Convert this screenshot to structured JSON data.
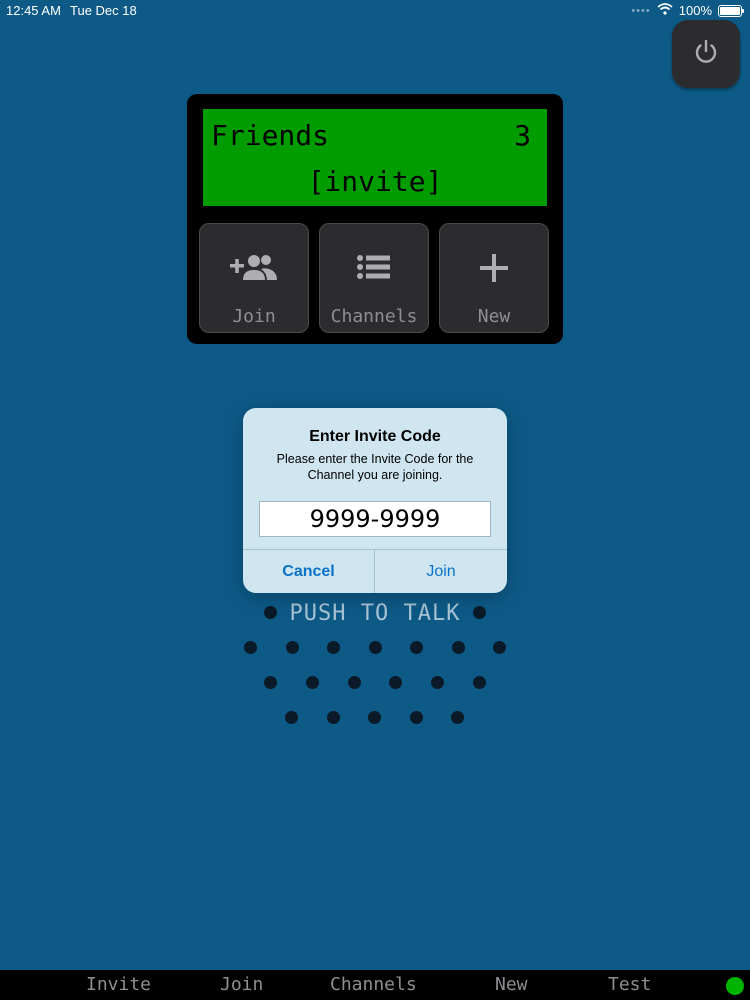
{
  "status_bar": {
    "time": "12:45 AM",
    "date": "Tue Dec 18",
    "battery": "100%"
  },
  "power_button": {
    "icon": "power-icon"
  },
  "radio": {
    "lcd": {
      "channel_name": "Friends",
      "member_count": "3",
      "action": "[invite]",
      "color": "#009c00"
    },
    "buttons": [
      {
        "label": "Join",
        "icon": "add-person-icon"
      },
      {
        "label": "Channels",
        "icon": "list-icon"
      },
      {
        "label": "New",
        "icon": "plus-icon"
      }
    ]
  },
  "dialog": {
    "title": "Enter Invite Code",
    "message": "Please enter the Invite Code for the Channel you are joining.",
    "input_value": "9999-9999",
    "cancel_label": "Cancel",
    "join_label": "Join",
    "accent_color": "#0a73c8"
  },
  "ptt": {
    "label": "PUSH TO TALK"
  },
  "bottom_bar": {
    "items": [
      "Invite",
      "Join",
      "Channels",
      "New",
      "Test"
    ],
    "status_color": "#00b400"
  }
}
